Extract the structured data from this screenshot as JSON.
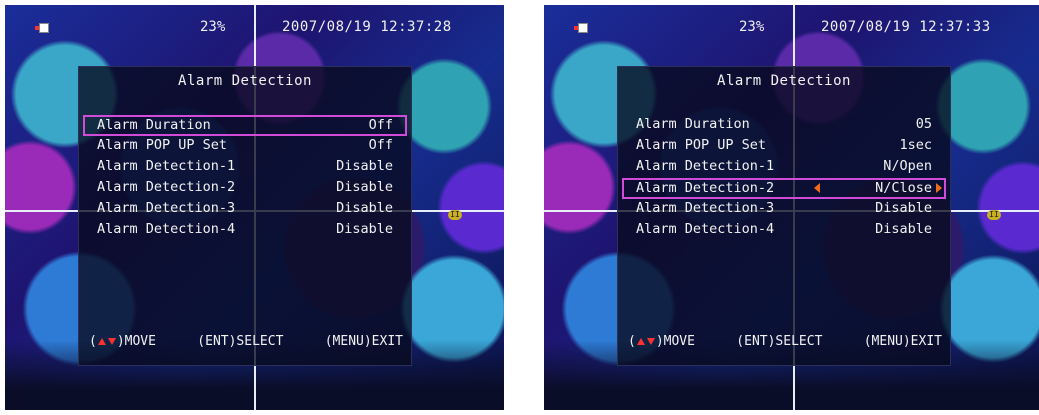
{
  "screens": [
    {
      "status": {
        "percent": "23%",
        "datetime": "2007/08/19 12:37:28"
      },
      "menu": {
        "title": "Alarm Detection",
        "items": [
          {
            "label": "Alarm Duration",
            "value": "Off",
            "selected": true
          },
          {
            "label": "Alarm POP UP Set",
            "value": "Off",
            "selected": false
          },
          {
            "label": "Alarm Detection-1",
            "value": "Disable",
            "selected": false
          },
          {
            "label": "Alarm Detection-2",
            "value": "Disable",
            "selected": false
          },
          {
            "label": "Alarm Detection-3",
            "value": "Disable",
            "selected": false
          },
          {
            "label": "Alarm Detection-4",
            "value": "Disable",
            "selected": false
          }
        ],
        "footer": {
          "open": "(",
          "move": ")MOVE",
          "select": "(ENT)SELECT",
          "exit": "(MENU)EXIT"
        }
      }
    },
    {
      "status": {
        "percent": "23%",
        "datetime": "2007/08/19 12:37:33"
      },
      "menu": {
        "title": "Alarm Detection",
        "items": [
          {
            "label": "Alarm Duration",
            "value": "05",
            "selected": false
          },
          {
            "label": "Alarm POP UP Set",
            "value": "1sec",
            "selected": false
          },
          {
            "label": "Alarm Detection-1",
            "value": "N/Open",
            "selected": false
          },
          {
            "label": "Alarm Detection-2",
            "value": "N/Close",
            "selected": true
          },
          {
            "label": "Alarm Detection-3",
            "value": "Disable",
            "selected": false
          },
          {
            "label": "Alarm Detection-4",
            "value": "Disable",
            "selected": false
          }
        ],
        "footer": {
          "open": "(",
          "move": ")MOVE",
          "select": "(ENT)SELECT",
          "exit": "(MENU)EXIT"
        }
      }
    }
  ],
  "colors": {
    "highlight": "#d24ad8",
    "arrow": "#f06a1c",
    "text": "#f2f2f2",
    "indicator": "#ff3030"
  }
}
